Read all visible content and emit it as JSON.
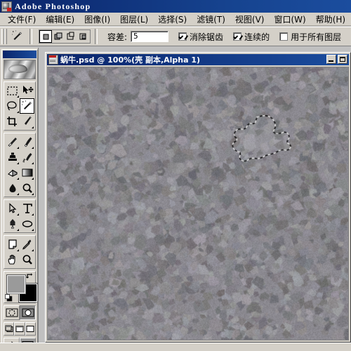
{
  "window": {
    "app_title": "Adobe Photoshop",
    "app_icon": "photoshop-icon"
  },
  "menubar": {
    "items": [
      {
        "label": "文件(F)",
        "name": "menu-file"
      },
      {
        "label": "编辑(E)",
        "name": "menu-edit"
      },
      {
        "label": "图像(I)",
        "name": "menu-image"
      },
      {
        "label": "图层(L)",
        "name": "menu-layer"
      },
      {
        "label": "选择(S)",
        "name": "menu-select"
      },
      {
        "label": "滤镜(T)",
        "name": "menu-filter"
      },
      {
        "label": "视图(V)",
        "name": "menu-view"
      },
      {
        "label": "窗口(W)",
        "name": "menu-window"
      },
      {
        "label": "帮助(H)",
        "name": "menu-help"
      }
    ]
  },
  "options_bar": {
    "active_tool_icon": "magic-wand-icon",
    "selection_modes": [
      {
        "name": "new-selection",
        "selected": true
      },
      {
        "name": "add-to-selection",
        "selected": false
      },
      {
        "name": "subtract-from-selection",
        "selected": false
      },
      {
        "name": "intersect-selection",
        "selected": false
      }
    ],
    "tolerance_label": "容差:",
    "tolerance_value": "5",
    "tolerance_placeholder": "0",
    "checkboxes": [
      {
        "label": "消除锯齿",
        "checked": true,
        "name": "anti-alias-checkbox"
      },
      {
        "label": "连续的",
        "checked": true,
        "name": "contiguous-checkbox"
      },
      {
        "label": "用于所有图层",
        "checked": false,
        "name": "all-layers-checkbox"
      }
    ]
  },
  "toolbox": {
    "banner_icon": "photoshop-eye-banner",
    "tools": [
      [
        {
          "name": "marquee-tool",
          "glyph": "marquee"
        },
        {
          "name": "move-tool",
          "glyph": "move"
        }
      ],
      [
        {
          "name": "lasso-tool",
          "glyph": "lasso"
        },
        {
          "name": "magic-wand-tool",
          "glyph": "wand",
          "active": true
        }
      ],
      [
        {
          "name": "crop-tool",
          "glyph": "crop"
        },
        {
          "name": "slice-tool",
          "glyph": "slice"
        }
      ],
      [
        {
          "name": "healing-brush-tool",
          "glyph": "heal"
        },
        {
          "name": "paintbrush-tool",
          "glyph": "brush"
        }
      ],
      [
        {
          "name": "clone-stamp-tool",
          "glyph": "stamp"
        },
        {
          "name": "history-brush-tool",
          "glyph": "historybrush"
        }
      ],
      [
        {
          "name": "eraser-tool",
          "glyph": "eraser"
        },
        {
          "name": "gradient-tool",
          "glyph": "gradient"
        }
      ],
      [
        {
          "name": "blur-tool",
          "glyph": "blur"
        },
        {
          "name": "dodge-tool",
          "glyph": "dodge"
        }
      ],
      [
        {
          "name": "path-selection-tool",
          "glyph": "pathsel"
        },
        {
          "name": "type-tool",
          "glyph": "type"
        }
      ],
      [
        {
          "name": "pen-tool",
          "glyph": "pen"
        },
        {
          "name": "ellipse-shape-tool",
          "glyph": "ellipse"
        }
      ],
      [
        {
          "name": "notes-tool",
          "glyph": "notes"
        },
        {
          "name": "eyedropper-tool",
          "glyph": "eyedropper"
        }
      ],
      [
        {
          "name": "hand-tool",
          "glyph": "hand"
        },
        {
          "name": "zoom-tool",
          "glyph": "zoom"
        }
      ]
    ],
    "colors": {
      "foreground": "#9a9a9a",
      "background": "#000000",
      "swap_icon": "swap-colors-icon",
      "default_icon": "default-colors-icon"
    },
    "quickmask": [
      {
        "name": "standard-mode-button",
        "selected": false
      },
      {
        "name": "quick-mask-mode-button",
        "selected": true
      }
    ],
    "screenmodes": [
      {
        "name": "standard-screen-mode-button"
      },
      {
        "name": "full-screen-with-menubar-button"
      },
      {
        "name": "full-screen-mode-button"
      }
    ],
    "jump": [
      {
        "name": "jump-to-imageready-button"
      },
      {
        "name": "imageready-preview-button"
      }
    ]
  },
  "document": {
    "title": "蜗牛.psd @ 100%(壳 副本,Alpha 1)",
    "icon": "document-icon",
    "buttons": [
      {
        "name": "doc-minimize-button"
      },
      {
        "name": "doc-maximize-button"
      }
    ],
    "canvas": {
      "description": "crystallized grey noise texture with marching-ants selection",
      "base_color": "#8a8890",
      "zoom": "100%",
      "selection": {
        "name": "marching-ants-selection",
        "center_x": 0.7,
        "center_y": 0.27
      }
    }
  }
}
